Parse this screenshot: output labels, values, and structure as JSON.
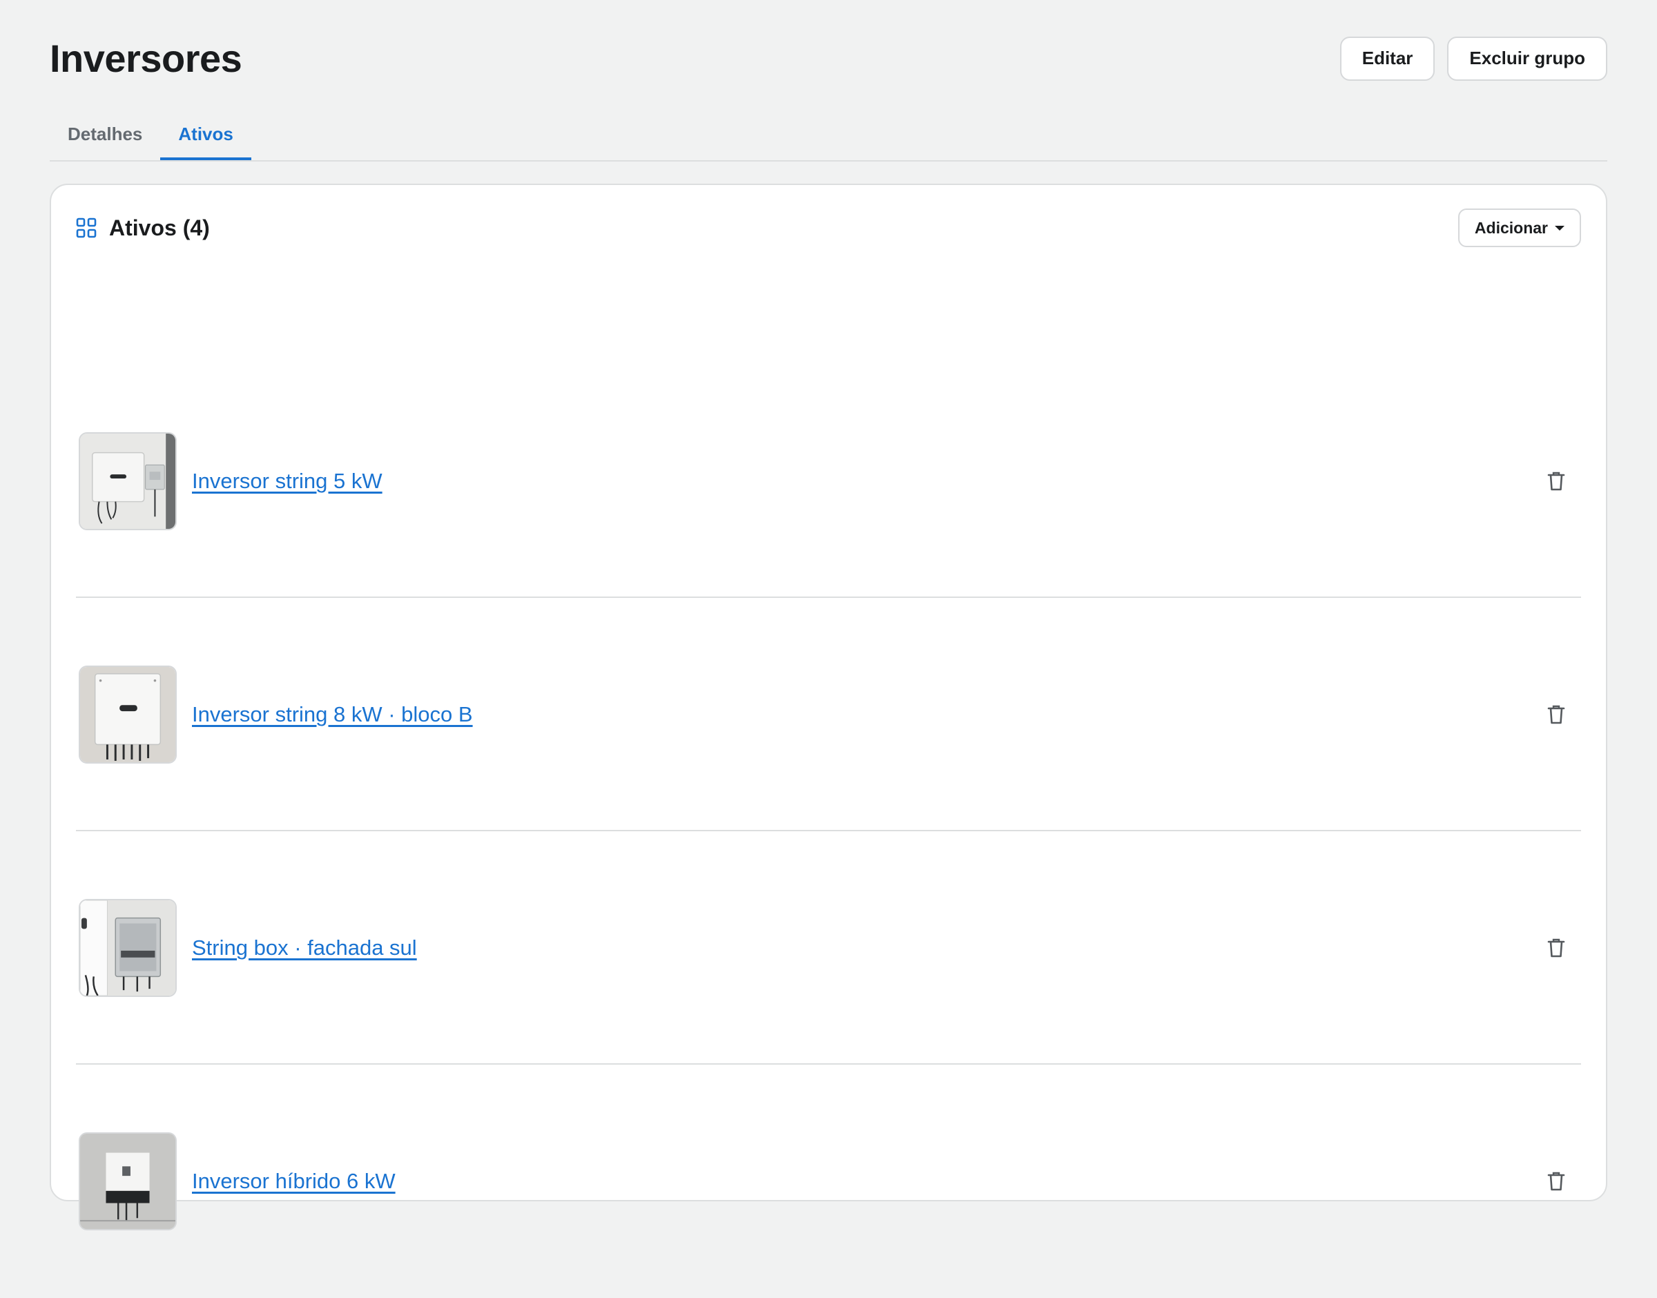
{
  "header": {
    "title": "Inversores",
    "edit_label": "Editar",
    "delete_group_label": "Excluir grupo"
  },
  "tabs": [
    {
      "label": "Detalhes",
      "active": false
    },
    {
      "label": "Ativos",
      "active": true
    }
  ],
  "assets_panel": {
    "title": "Ativos (4)",
    "title_icon": "grid-icon",
    "add_label": "Adicionar",
    "add_icon": "caret-down-icon",
    "items": [
      {
        "name": "Inversor string 5 kW",
        "thumbnail": "inverter-with-breaker-photo",
        "action_icon": "trash-icon"
      },
      {
        "name": "Inversor string 8 kW · bloco B",
        "thumbnail": "inverter-photo",
        "action_icon": "trash-icon"
      },
      {
        "name": "String box · fachada sul",
        "thumbnail": "string-box-photo",
        "action_icon": "trash-icon"
      },
      {
        "name": "Inversor híbrido 6 kW",
        "thumbnail": "hybrid-inverter-photo",
        "action_icon": "trash-icon"
      }
    ]
  },
  "colors": {
    "accent": "#1a73d1",
    "background": "#f1f2f2",
    "text": "#1a1c1e",
    "muted_text": "#646a70",
    "border": "#dcdedf"
  }
}
